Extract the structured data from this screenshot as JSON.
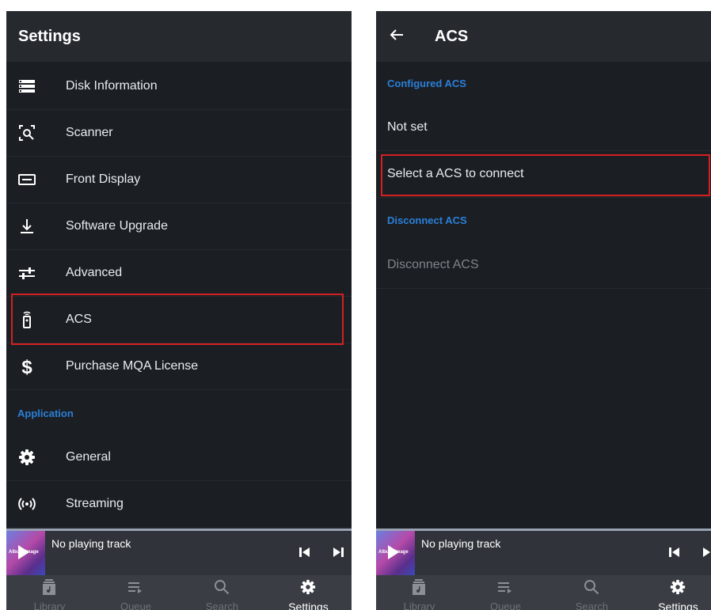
{
  "left": {
    "title": "Settings",
    "items": [
      {
        "label": "Disk Information",
        "icon": "list-icon"
      },
      {
        "label": "Scanner",
        "icon": "scan-icon"
      },
      {
        "label": "Front Display",
        "icon": "display-icon"
      },
      {
        "label": "Software Upgrade",
        "icon": "download-icon"
      },
      {
        "label": "Advanced",
        "icon": "sliders-icon"
      },
      {
        "label": "ACS",
        "icon": "remote-icon"
      },
      {
        "label": "Purchase MQA License",
        "icon": "dollar-icon"
      }
    ],
    "section_application": "Application",
    "app_items": [
      {
        "label": "General",
        "icon": "gear-icon"
      },
      {
        "label": "Streaming",
        "icon": "streaming-icon"
      }
    ]
  },
  "right": {
    "title": "ACS",
    "section_configured": "Configured ACS",
    "not_set": "Not set",
    "select_acs": "Select a ACS to connect",
    "section_disconnect": "Disconnect ACS",
    "disconnect": "Disconnect ACS"
  },
  "player": {
    "album_text": "Album Image",
    "status": "No playing track"
  },
  "nav": {
    "tabs": [
      {
        "label": "Library"
      },
      {
        "label": "Queue"
      },
      {
        "label": "Search"
      },
      {
        "label": "Settings"
      }
    ]
  },
  "colors": {
    "background": "#1b1f24",
    "appbar": "#262a2f",
    "section_accent": "#2b7fd8",
    "highlight": "#d42020"
  }
}
